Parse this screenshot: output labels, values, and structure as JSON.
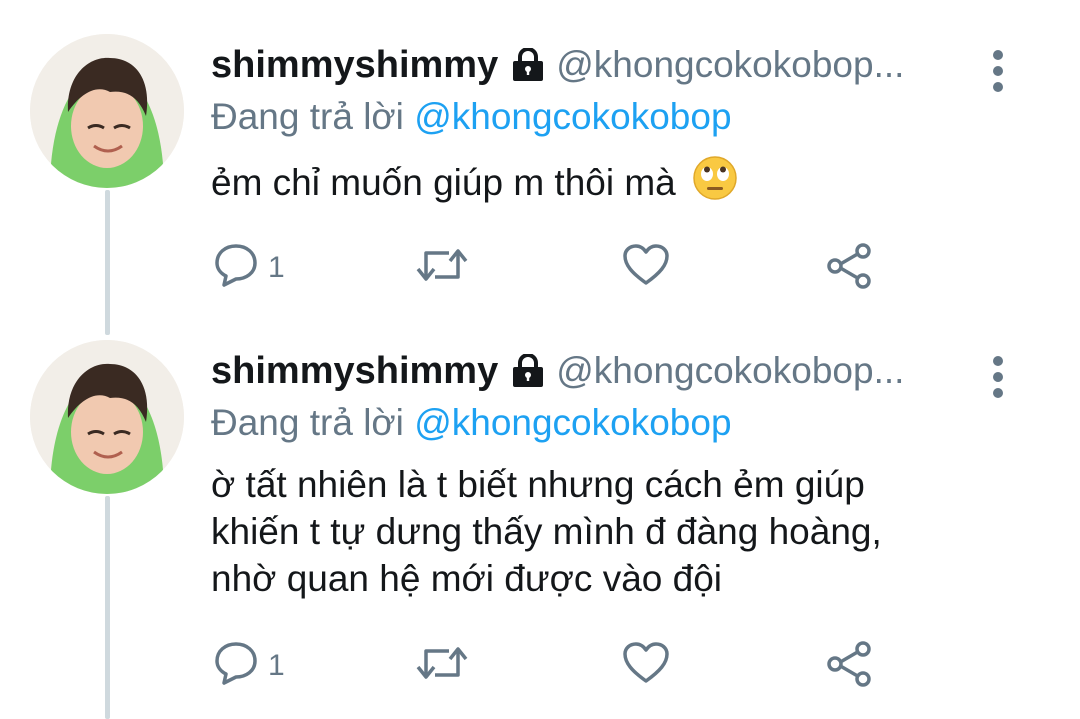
{
  "tweets": [
    {
      "display_name": "shimmyshimmy",
      "handle": "@khongcokokobop...",
      "replying_prefix": "Đang trả lời",
      "replying_to": "@khongcokokobop",
      "text_lines": [
        "ẻm chỉ muốn giúp m thôi mà"
      ],
      "emoji": "face-with-rolling-eyes",
      "reply_count": "1"
    },
    {
      "display_name": "shimmyshimmy",
      "handle": "@khongcokokobop...",
      "replying_prefix": "Đang trả lời",
      "replying_to": "@khongcokokobop",
      "text_lines": [
        "ờ tất nhiên là t biết nhưng cách ẻm giúp",
        "khiến t tự dưng thấy mình đ đàng hoàng,",
        "nhờ quan hệ mới được vào đội"
      ],
      "reply_count": "1"
    }
  ],
  "colors": {
    "secondary_text": "#657786",
    "link": "#1da1f2",
    "thread_line": "#cfd9de",
    "avatar_hood": "#7ccf6a"
  }
}
